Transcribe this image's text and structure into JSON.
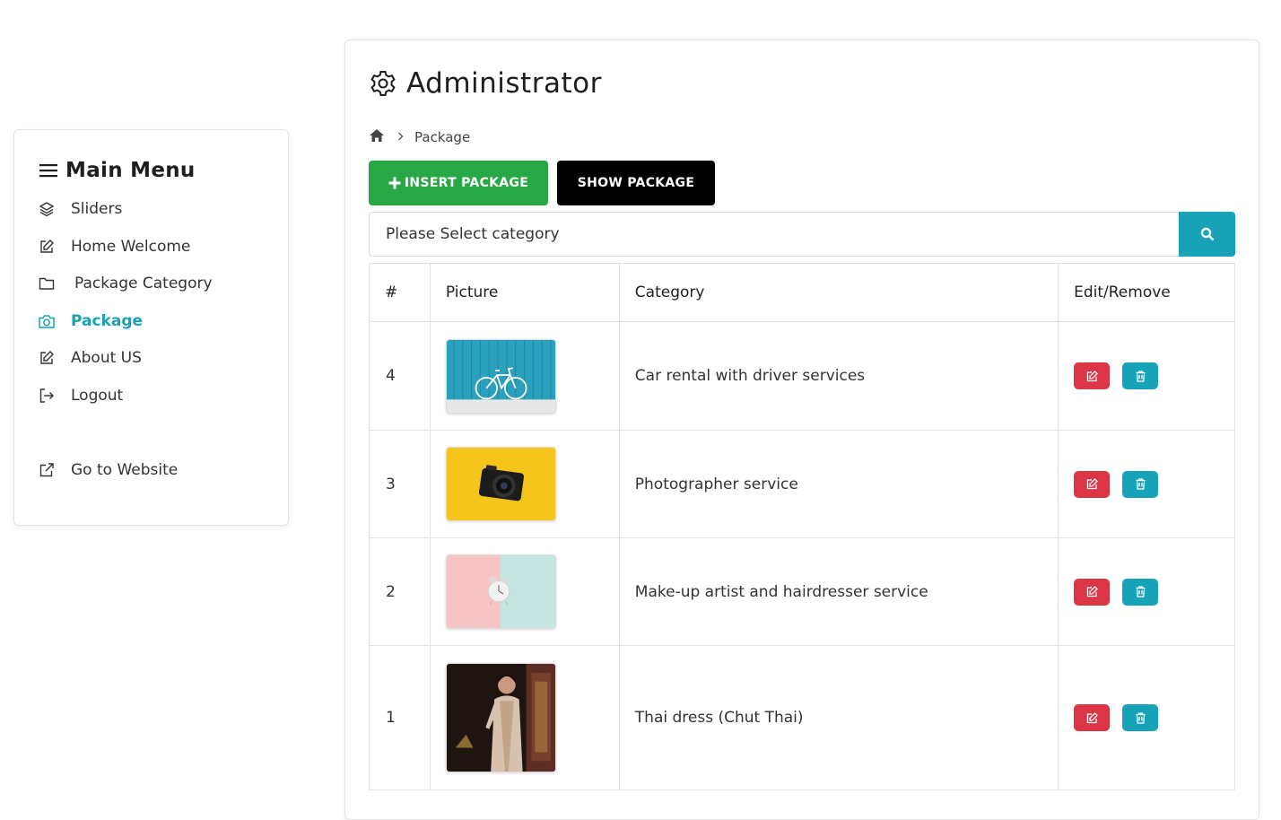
{
  "sidebar": {
    "title": "Main Menu",
    "items": [
      {
        "label": "Sliders",
        "icon": "layers-icon"
      },
      {
        "label": "Home Welcome",
        "icon": "edit-icon"
      },
      {
        "label": "Package Category",
        "icon": "folder-icon"
      },
      {
        "label": "Package",
        "icon": "camera-icon",
        "active": true
      },
      {
        "label": "About US",
        "icon": "edit-icon"
      },
      {
        "label": "Logout",
        "icon": "sign-out-icon"
      }
    ],
    "website_link": "Go to Website"
  },
  "main": {
    "title": "Administrator",
    "breadcrumb": {
      "current": "Package"
    },
    "insert_button": "INSERT PACKAGE",
    "show_button": "SHOW PACKAGE",
    "category_select": {
      "value": "Please Select category"
    },
    "table": {
      "headers": [
        "#",
        "Picture",
        "Category",
        "Edit/Remove"
      ],
      "rows": [
        {
          "num": "4",
          "category": "Car rental with driver services",
          "picture": "bicycle-photo"
        },
        {
          "num": "3",
          "category": "Photographer service",
          "picture": "camera-photo"
        },
        {
          "num": "2",
          "category": "Make-up artist and hairdresser service",
          "picture": "alarm-clock-photo"
        },
        {
          "num": "1",
          "category": "Thai dress (Chut Thai)",
          "picture": "thai-dress-photo"
        }
      ]
    }
  },
  "colors": {
    "accent": "#17a2b8",
    "insert": "#28a745",
    "show": "#000000",
    "edit": "#dc3545",
    "delete": "#17a2b8"
  }
}
